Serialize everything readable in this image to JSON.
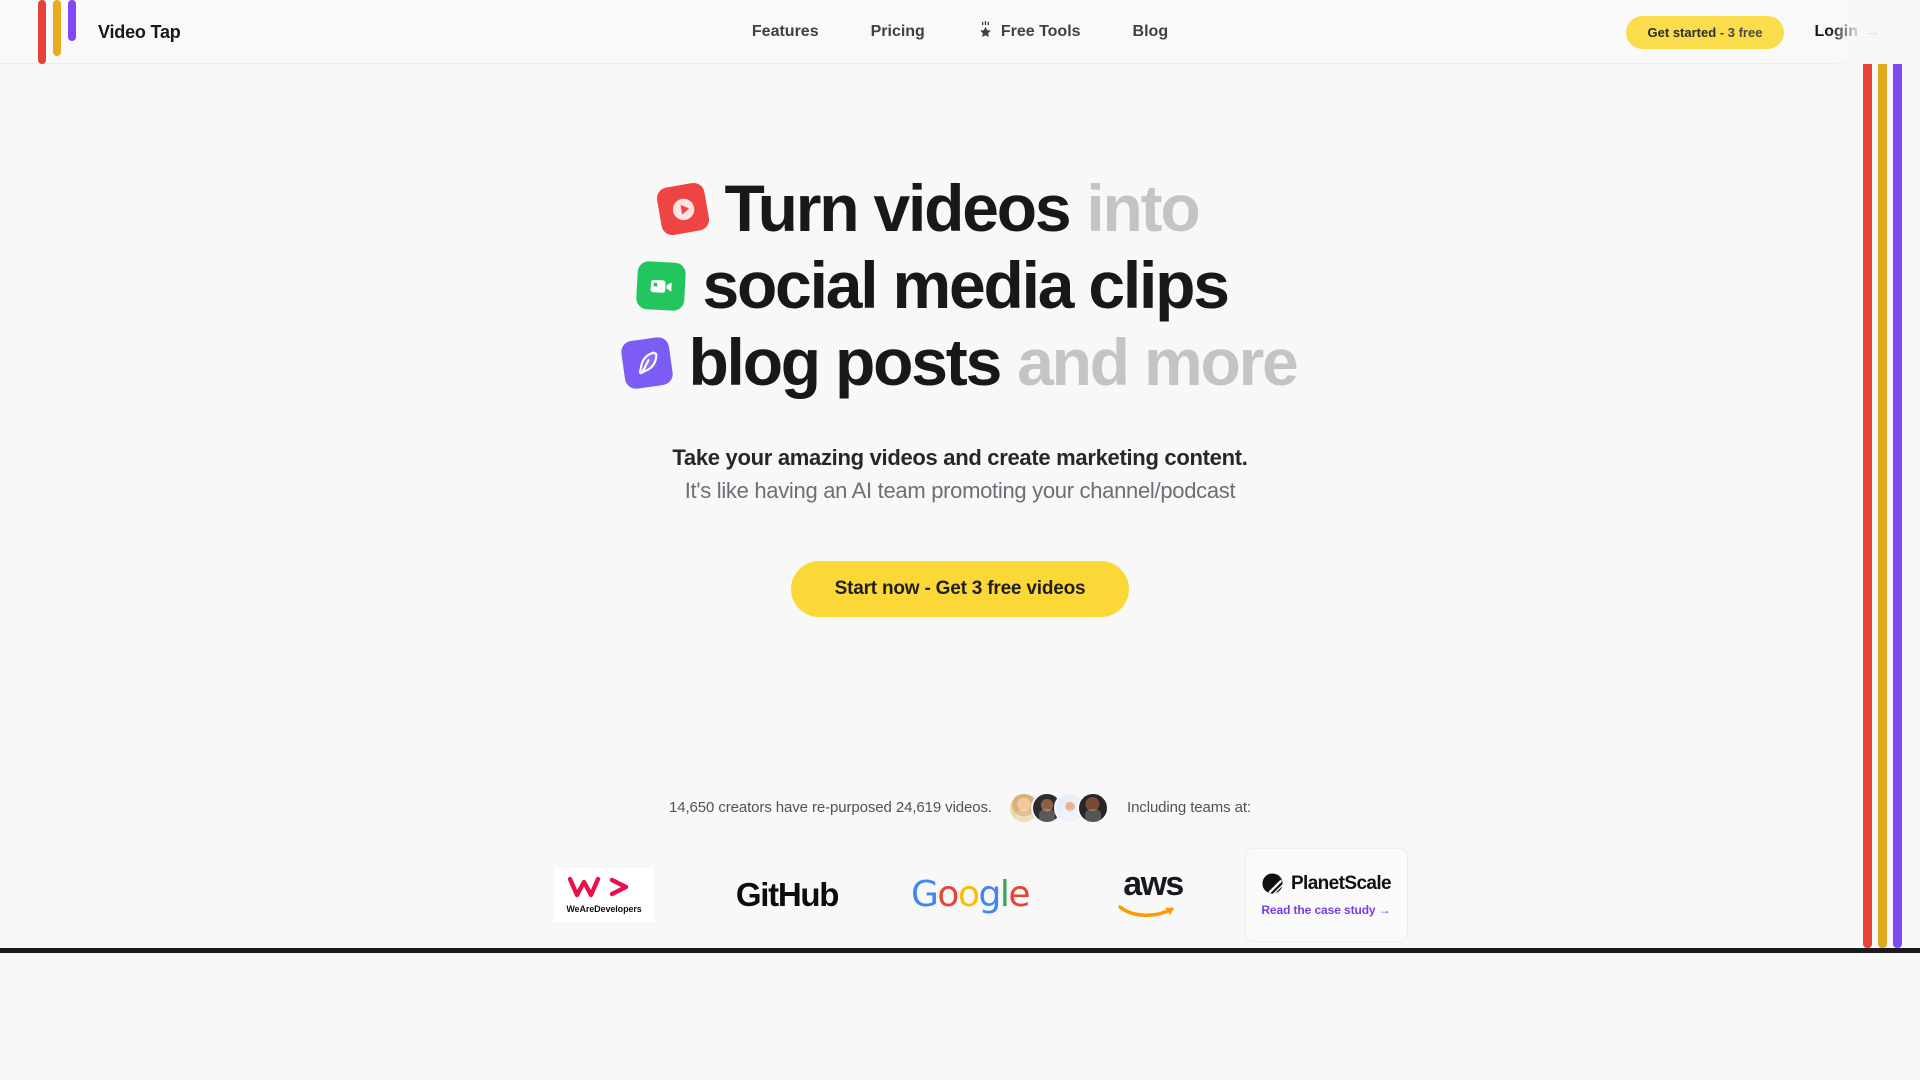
{
  "brand": {
    "name": "Video Tap",
    "logo_icon": "three-bars-logo"
  },
  "colors": {
    "accent_yellow": "#fbdd4c",
    "bar_red": "#e8413a",
    "bar_yellow": "#e8aa1e",
    "bar_purple": "#8149f2",
    "icon_red": "#ef4444",
    "icon_green": "#22c55e",
    "icon_purple": "#7c5cf5",
    "link_purple": "#7c3aed"
  },
  "nav": {
    "items": [
      {
        "label": "Features",
        "icon": null
      },
      {
        "label": "Pricing",
        "icon": null
      },
      {
        "label": "Free Tools",
        "icon": "sparkle-star-icon"
      },
      {
        "label": "Blog",
        "icon": null
      }
    ]
  },
  "header_actions": {
    "get_started_main": "Get started",
    "get_started_sub": "- 3 free",
    "login_label": "Login",
    "login_arrow": "→"
  },
  "hero": {
    "lines": [
      {
        "icon": "video-play-icon",
        "strong": "Turn videos",
        "muted": "into"
      },
      {
        "icon": "video-camera-icon",
        "strong": "social media clips",
        "muted": ""
      },
      {
        "icon": "pen-nib-icon",
        "strong": "blog posts",
        "muted": "and more"
      }
    ],
    "subtitle_strong": "Take your amazing videos and create marketing content.",
    "subtitle_light": "It's like having an AI team promoting your channel/podcast",
    "cta_label": "Start now - Get 3 free videos"
  },
  "social_proof": {
    "stat_text": "14,650 creators have re-purposed 24,619 videos.",
    "creators_count": "14,650",
    "videos_count": "24,619",
    "including_label": "Including teams at:",
    "avatars": [
      "avatar-1",
      "avatar-2",
      "avatar-3",
      "avatar-4"
    ]
  },
  "logos": [
    {
      "name": "WeAreDevelopers",
      "wordmark": "WeAreDevelopers"
    },
    {
      "name": "GitHub",
      "wordmark": "GitHub"
    },
    {
      "name": "Google",
      "wordmark": "Google"
    },
    {
      "name": "aws",
      "wordmark": "aws"
    },
    {
      "name": "PlanetScale",
      "wordmark": "PlanetScale",
      "link": "Read the case study →"
    }
  ]
}
